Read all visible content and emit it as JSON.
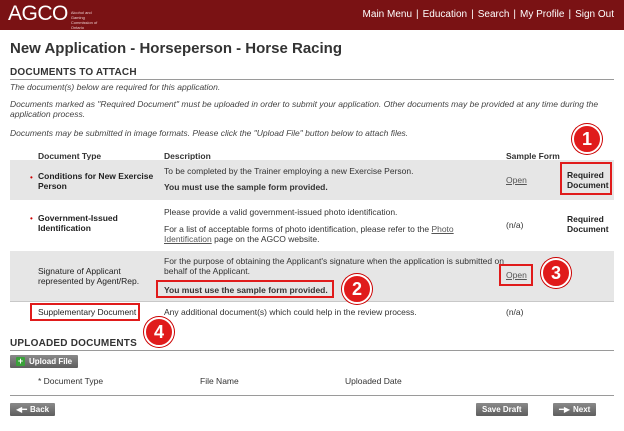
{
  "header": {
    "logo": "AGCO",
    "logo_subtitle": "Alcohol and Gaming Commission of Ontario",
    "nav": [
      "Main Menu",
      "Education",
      "Search",
      "My Profile",
      "Sign Out"
    ]
  },
  "page_title": "New Application - Horseperson - Horse Racing",
  "documents_section": {
    "title": "DOCUMENTS TO ATTACH",
    "intro_1": "The document(s) below are required for this application.",
    "intro_2": "Documents marked as \"Required Document\" must be uploaded in order to submit your application. Other documents may be provided at any time during the application process.",
    "intro_3": "Documents may be submitted in image formats. Please click the \"Upload File\" button below to attach files.",
    "columns": {
      "doc_type": "Document Type",
      "description": "Description",
      "sample_form": "Sample Form"
    },
    "rows": [
      {
        "required": true,
        "doc_type": "Conditions for New Exercise Person",
        "desc_1": "To be completed by the Trainer employing a new Exercise Person.",
        "desc_2": "You must use the sample form provided.",
        "sample": "Open",
        "required_label": "Required Document"
      },
      {
        "required": true,
        "doc_type": "Government-Issued Identification",
        "desc_1": "Please provide a valid government-issued photo identification.",
        "desc_2_pre": "For a list of acceptable forms of photo identification, please refer to the ",
        "desc_2_link": "Photo Identification",
        "desc_2_post": " page on the AGCO website.",
        "sample": "(n/a)",
        "required_label": "Required Document"
      },
      {
        "required": false,
        "doc_type": "Signature of Applicant represented by Agent/Rep.",
        "desc_1": "For the purpose of obtaining the Applicant's signature when the application is submitted on behalf of the Applicant.",
        "desc_2": "You must use the sample form provided.",
        "sample": "Open",
        "required_label": ""
      },
      {
        "required": false,
        "doc_type": "Supplementary Document",
        "desc_1": "Any additional document(s) which could help in the review process.",
        "sample": "(n/a)",
        "required_label": ""
      }
    ]
  },
  "uploaded_section": {
    "title": "UPLOADED DOCUMENTS",
    "upload_button": "Upload File",
    "columns": {
      "doc_type": "* Document Type",
      "file_name": "File Name",
      "uploaded_date": "Uploaded Date"
    }
  },
  "footer": {
    "back": "Back",
    "save_draft": "Save Draft",
    "next": "Next"
  },
  "annotations": [
    "1",
    "2",
    "3",
    "4"
  ],
  "colors": {
    "header_bg": "#7a1214",
    "annotation_red": "#e01b1b",
    "row_shade": "#e6e6e6"
  }
}
